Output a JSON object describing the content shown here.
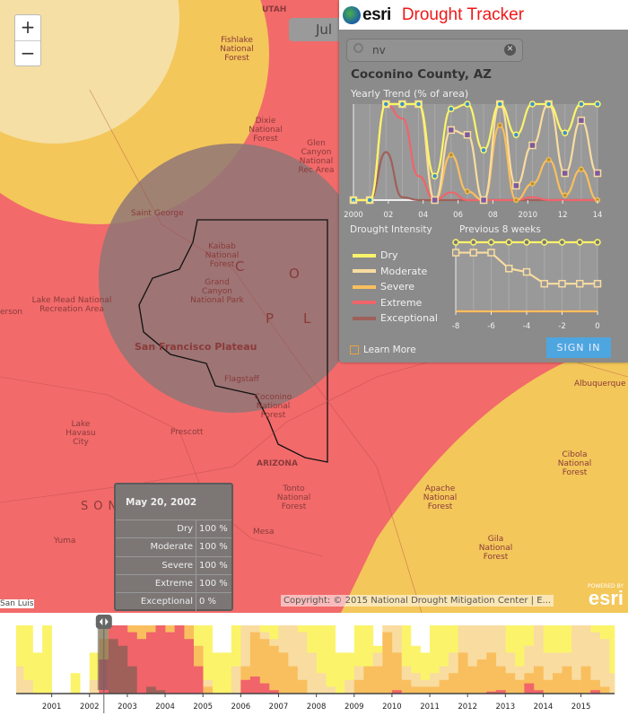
{
  "map": {
    "date_chip": "Jul",
    "zoom_in": "+",
    "zoom_out": "−",
    "labels": [
      "UTAH",
      "Fishlake National Forest",
      "Dixie National Forest",
      "Glen Canyon National Rec Area",
      "Saint George",
      "Kaibab National Forest",
      "Grand Canyon National Park",
      "Lake Mead National Recreation Area",
      "San Francisco Plateau",
      "Flagstaff",
      "Prescott",
      "Coconino National Forest",
      "ARIZONA",
      "Lake Havasu City",
      "Tonto National Forest",
      "Apache National Forest",
      "Cibola National Forest",
      "Gila National Forest",
      "Mesa",
      "Yuma",
      "Albuquerque",
      "San Luis",
      "erson",
      "C",
      "O",
      "P",
      "L",
      "SON"
    ],
    "copyright": "Copyright: © 2015 National Drought Mitigation Center | E...",
    "powered_by": "POWERED BY",
    "powered_logo": "esri"
  },
  "panel": {
    "logo": "esri",
    "title": "Drought Tracker",
    "search": {
      "value": "nv",
      "icon": "search-icon",
      "clear_icon": "close-icon"
    },
    "county": "Coconino County, AZ",
    "yearly_title": "Yearly Trend (% of area)",
    "intensity_title": "Drought Intensity",
    "weeks_title": "Previous 8 weeks",
    "legend": [
      {
        "label": "Dry",
        "color": "#fbf46a"
      },
      {
        "label": "Moderate",
        "color": "#f9dca0"
      },
      {
        "label": "Severe",
        "color": "#f9bf5e"
      },
      {
        "label": "Extreme",
        "color": "#f0646a"
      },
      {
        "label": "Exceptional",
        "color": "#a0605a"
      }
    ],
    "learn_more": "Learn More",
    "sign_in": "SIGN IN"
  },
  "tooltip": {
    "date": "May 20, 2002",
    "rows": [
      {
        "label": "Dry",
        "value": "100 %"
      },
      {
        "label": "Moderate",
        "value": "100 %"
      },
      {
        "label": "Severe",
        "value": "100 %"
      },
      {
        "label": "Extreme",
        "value": "100 %"
      },
      {
        "label": "Exceptional",
        "value": "0 %"
      }
    ]
  },
  "chart_data": [
    {
      "type": "line",
      "title": "Yearly Trend (% of area)",
      "x": [
        2000,
        2001,
        2002,
        2003,
        2004,
        2005,
        2006,
        2007,
        2008,
        2009,
        2010,
        2011,
        2012,
        2013,
        2014,
        2015
      ],
      "xticks": [
        "2000",
        "02",
        "04",
        "06",
        "08",
        "2010",
        "12",
        "14"
      ],
      "ylim": [
        0,
        100
      ],
      "series": [
        {
          "name": "Dry",
          "values": [
            0,
            0,
            100,
            100,
            100,
            25,
            95,
            100,
            52,
            100,
            68,
            100,
            100,
            70,
            100,
            100
          ]
        },
        {
          "name": "Moderate",
          "values": [
            0,
            0,
            100,
            100,
            100,
            0,
            73,
            68,
            0,
            100,
            15,
            57,
            100,
            28,
            83,
            28
          ]
        },
        {
          "name": "Severe",
          "values": [
            0,
            0,
            100,
            100,
            100,
            0,
            47,
            9,
            0,
            78,
            0,
            17,
            42,
            5,
            32,
            0
          ]
        },
        {
          "name": "Extreme",
          "values": [
            0,
            0,
            100,
            85,
            25,
            0,
            8,
            0,
            0,
            0,
            0,
            3,
            0,
            0,
            0,
            0
          ]
        },
        {
          "name": "Exceptional",
          "values": [
            0,
            0,
            50,
            3,
            0,
            0,
            0,
            0,
            0,
            0,
            0,
            0,
            0,
            0,
            0,
            0
          ]
        }
      ]
    },
    {
      "type": "line",
      "title": "Previous 8 weeks",
      "x": [
        -8,
        -7,
        -6,
        -5,
        -4,
        -3,
        -2,
        -1,
        0
      ],
      "xticks": [
        "-8",
        "-6",
        "-4",
        "-2",
        "0"
      ],
      "ylim": [
        0,
        100
      ],
      "series": [
        {
          "name": "Dry",
          "values": [
            100,
            100,
            100,
            100,
            100,
            100,
            100,
            100,
            100
          ]
        },
        {
          "name": "Moderate",
          "values": [
            85,
            85,
            85,
            62,
            57,
            40,
            40,
            40,
            40
          ]
        },
        {
          "name": "Severe",
          "values": [
            0,
            0,
            0,
            0,
            0,
            0,
            0,
            0,
            0
          ]
        },
        {
          "name": "Extreme",
          "values": [
            0,
            0,
            0,
            0,
            0,
            0,
            0,
            0,
            0
          ]
        },
        {
          "name": "Exceptional",
          "values": [
            0,
            0,
            0,
            0,
            0,
            0,
            0,
            0,
            0
          ]
        }
      ]
    },
    {
      "type": "area",
      "title": "",
      "x_start": 2000,
      "step": "quarter",
      "xticks": [
        "2001",
        "2002",
        "2003",
        "2004",
        "2005",
        "2006",
        "2007",
        "2008",
        "2009",
        "2010",
        "2011",
        "2012",
        "2013",
        "2014",
        "2015"
      ],
      "ylim": [
        0,
        100
      ],
      "selected": "May 20, 2002",
      "series": [
        {
          "name": "Dry",
          "values": [
            100,
            100,
            60,
            100,
            0,
            0,
            30,
            0,
            60,
            100,
            100,
            100,
            100,
            100,
            100,
            100,
            100,
            100,
            100,
            100,
            100,
            60,
            60,
            100,
            100,
            100,
            100,
            100,
            100,
            100,
            100,
            100,
            100,
            100,
            60,
            60,
            100,
            100,
            70,
            100,
            100,
            100,
            70,
            60,
            100,
            100,
            100,
            100,
            100,
            100,
            100,
            100,
            100,
            100,
            100,
            100,
            100,
            100,
            100,
            100,
            100,
            100,
            100,
            100
          ]
        },
        {
          "name": "Moderate",
          "values": [
            40,
            20,
            0,
            0,
            0,
            0,
            0,
            0,
            20,
            100,
            100,
            100,
            100,
            100,
            100,
            100,
            100,
            100,
            100,
            70,
            20,
            0,
            0,
            40,
            100,
            100,
            90,
            80,
            100,
            100,
            90,
            60,
            30,
            10,
            0,
            20,
            40,
            40,
            60,
            100,
            100,
            40,
            30,
            20,
            30,
            40,
            60,
            100,
            100,
            100,
            100,
            100,
            60,
            40,
            70,
            100,
            60,
            60,
            60,
            100,
            100,
            90,
            80,
            30
          ]
        },
        {
          "name": "Severe",
          "values": [
            0,
            0,
            0,
            0,
            0,
            0,
            0,
            0,
            0,
            80,
            100,
            100,
            100,
            100,
            100,
            100,
            100,
            100,
            100,
            70,
            10,
            0,
            0,
            0,
            40,
            90,
            80,
            70,
            60,
            40,
            20,
            0,
            0,
            0,
            0,
            0,
            20,
            40,
            40,
            90,
            60,
            20,
            10,
            10,
            10,
            20,
            30,
            60,
            40,
            50,
            60,
            40,
            30,
            20,
            30,
            40,
            20,
            30,
            40,
            20,
            40,
            20,
            10,
            0
          ]
        },
        {
          "name": "Extreme",
          "values": [
            0,
            0,
            0,
            0,
            0,
            0,
            0,
            0,
            0,
            50,
            100,
            100,
            90,
            80,
            90,
            100,
            90,
            100,
            80,
            40,
            0,
            0,
            0,
            0,
            20,
            25,
            15,
            5,
            0,
            0,
            0,
            0,
            0,
            0,
            0,
            0,
            0,
            0,
            0,
            0,
            5,
            0,
            0,
            0,
            0,
            0,
            0,
            0,
            0,
            0,
            3,
            5,
            0,
            0,
            15,
            5,
            0,
            0,
            0,
            0,
            0,
            5,
            0,
            0
          ]
        },
        {
          "name": "Exceptional",
          "values": [
            0,
            0,
            0,
            0,
            0,
            0,
            0,
            0,
            0,
            0,
            80,
            70,
            40,
            0,
            10,
            5,
            0,
            0,
            0,
            0,
            0,
            0,
            0,
            0,
            0,
            0,
            0,
            0,
            0,
            0,
            0,
            0,
            0,
            0,
            0,
            0,
            0,
            0,
            0,
            0,
            0,
            0,
            0,
            0,
            0,
            0,
            0,
            0,
            0,
            0,
            0,
            0,
            0,
            0,
            0,
            0,
            0,
            0,
            0,
            0,
            0,
            0,
            0,
            0
          ]
        }
      ]
    }
  ]
}
